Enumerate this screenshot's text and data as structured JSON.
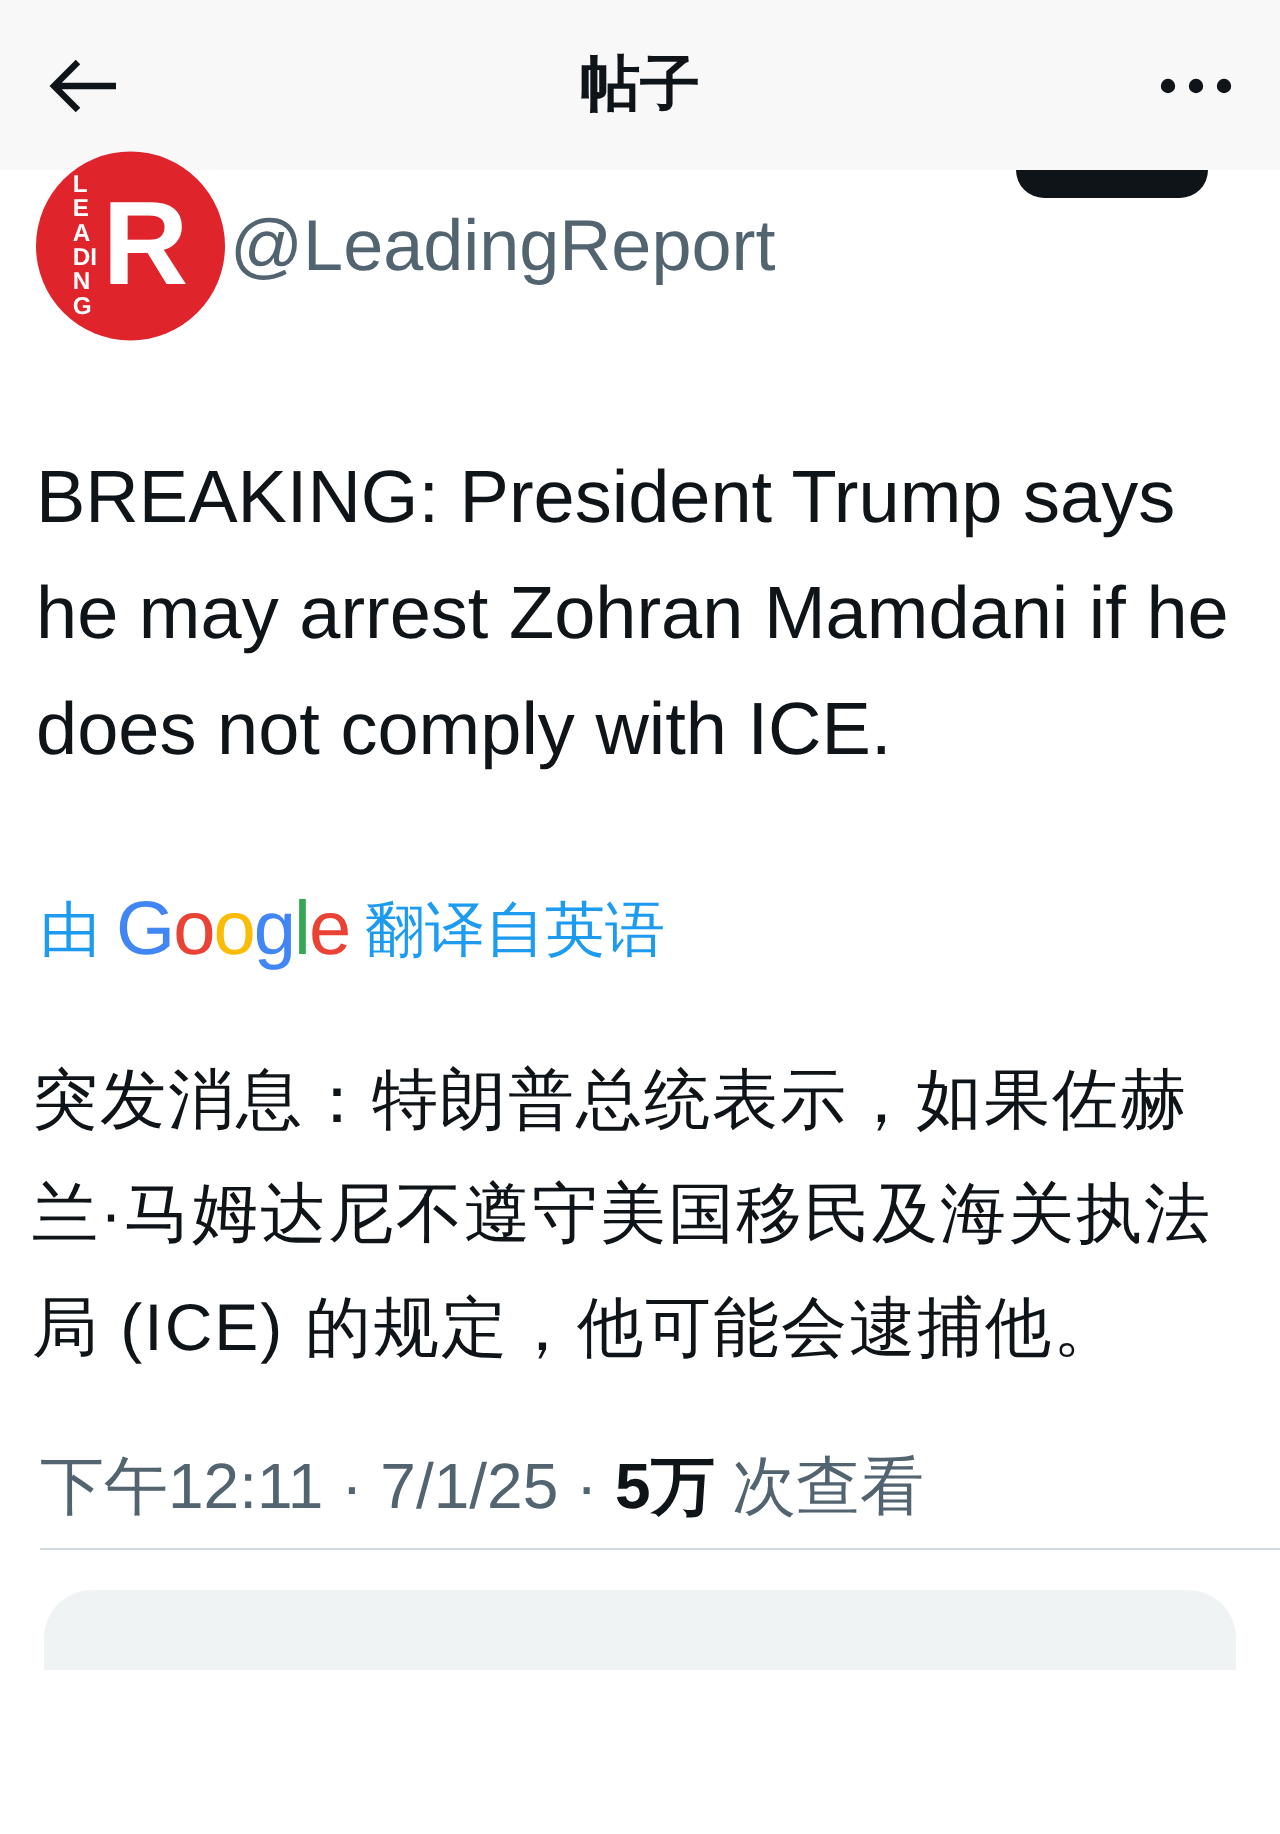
{
  "header": {
    "title": "帖子"
  },
  "author": {
    "handle": "@LeadingReport",
    "logo_word": "LEADING",
    "logo_letter": "R"
  },
  "tweet": {
    "text": "BREAKING: President Trump says he may arrest Zohran Mamdani if he does not comply with ICE."
  },
  "translation": {
    "prefix": "由",
    "brand": "Google",
    "suffix": "翻译自英语",
    "text": "突发消息：特朗普总统表示，如果佐赫兰·马姆达尼不遵守美国移民及海关执法局 (ICE) 的规定，他可能会逮捕他。"
  },
  "meta": "下午12:11 · 7/1/25 · **5万** 次查看"
}
